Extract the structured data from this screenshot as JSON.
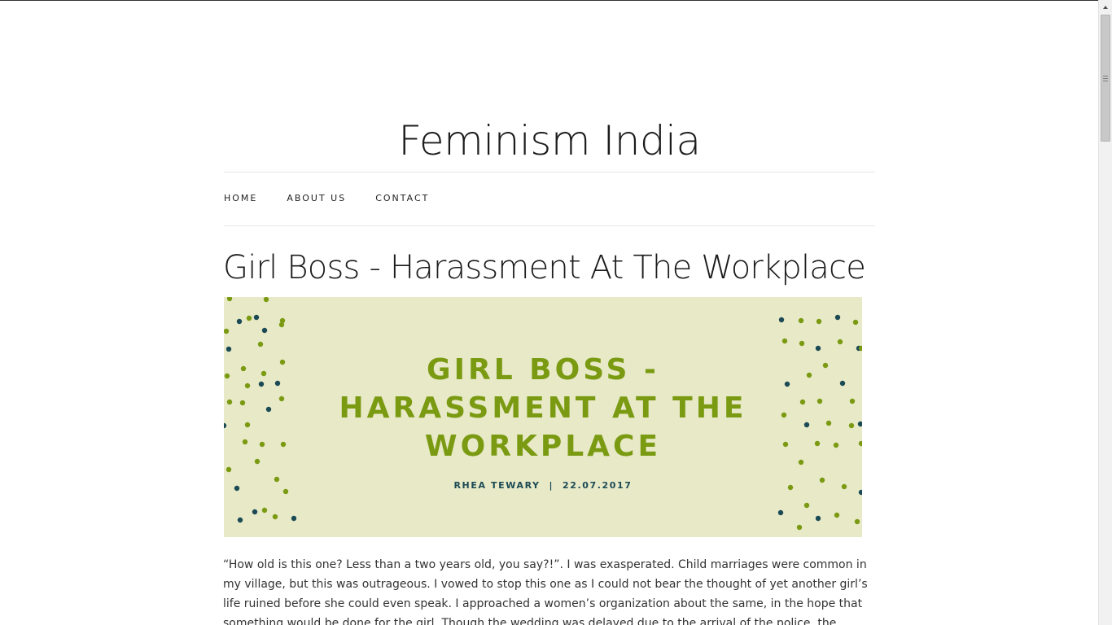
{
  "site": {
    "title": "Feminism India"
  },
  "nav": {
    "items": [
      {
        "label": "HOME"
      },
      {
        "label": "ABOUT US"
      },
      {
        "label": "CONTACT"
      }
    ]
  },
  "post": {
    "title": "Girl Boss - Harassment At The Workplace",
    "banner": {
      "title_lines": [
        "GIRL BOSS -",
        "HARASSMENT AT THE",
        "WORKPLACE"
      ],
      "byline": "RHEA TEWARY  |  22.07.2017",
      "background": "#e8e9c7",
      "title_color": "#7a9a12",
      "dot_colors": [
        "#7a9a12",
        "#1b4a55"
      ]
    },
    "body": "“How old is this one? Less than a two years old, you say?!”. I was exasperated. Child marriages were common in my village, but this was outrageous. I vowed to stop this one as I could not bear the thought of yet another girl’s life ruined before she could even speak. I approached a women’s organization about the same, in the hope that something would be done for the girl. Though the wedding was delayed due to the arrival of the police, the family"
  },
  "icons": {
    "scroll_up": "arrow-up-icon",
    "scroll_grip": "grip-icon"
  }
}
